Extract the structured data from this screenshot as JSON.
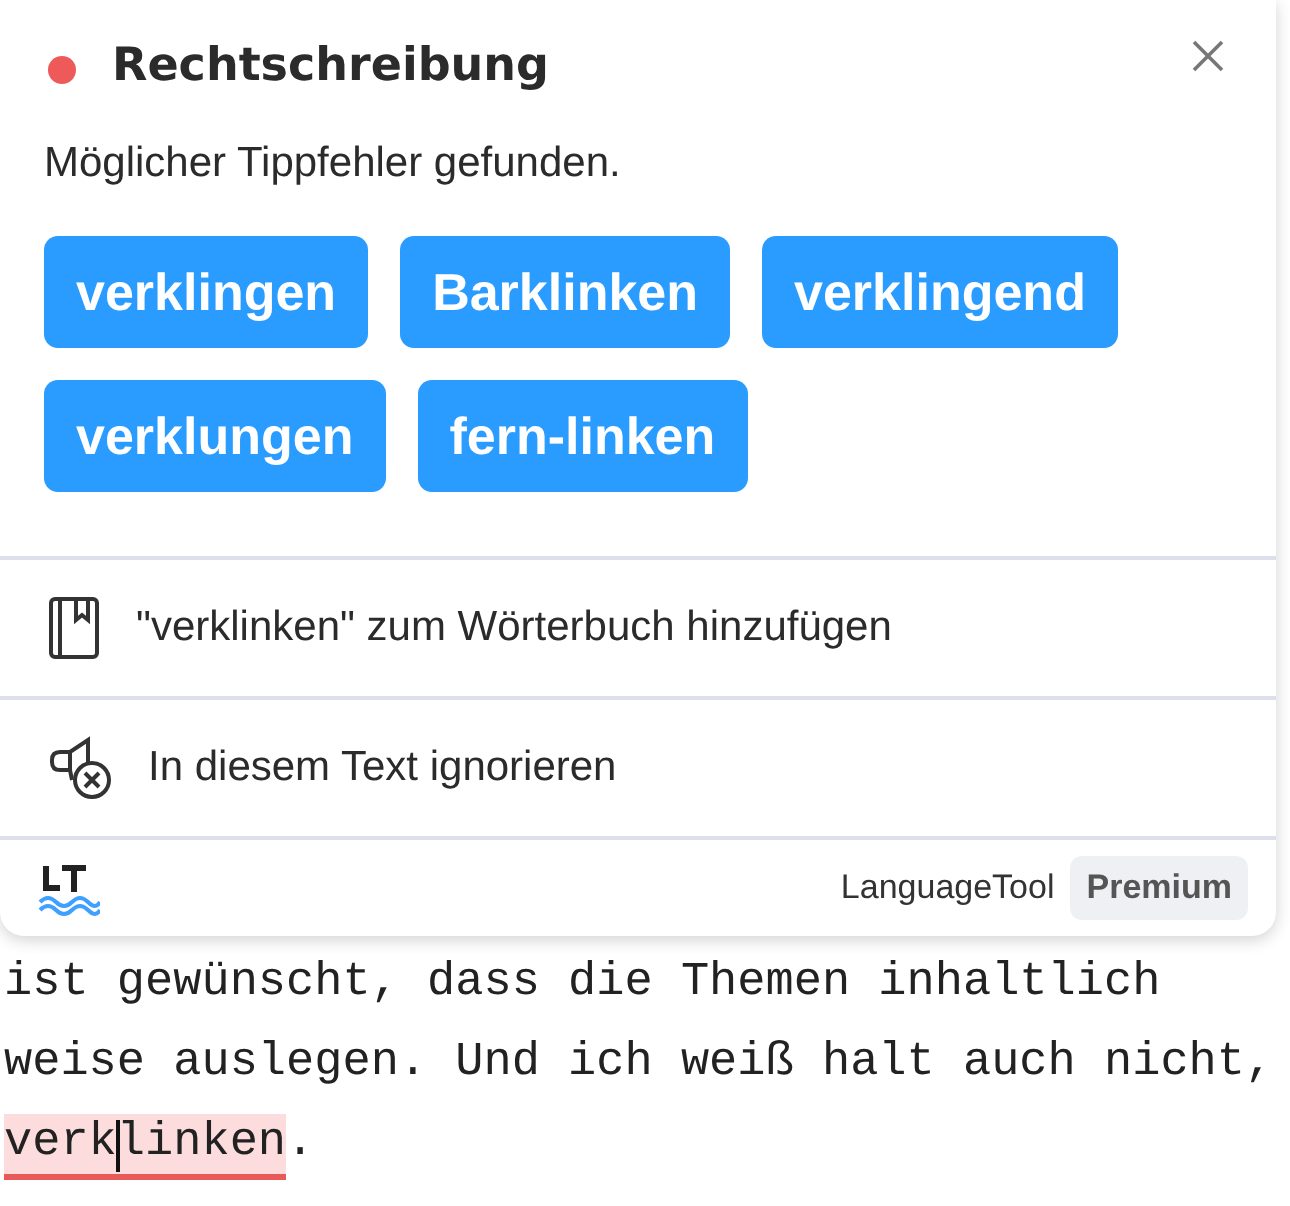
{
  "popup": {
    "category": {
      "title": "Rechtschreibung",
      "color": "#ee5a5a"
    },
    "message": "Möglicher Tippfehler gefunden.",
    "suggestions": [
      "verklingen",
      "Barklinken",
      "verklingend",
      "verklungen",
      "fern-linken"
    ],
    "actions": [
      {
        "kind": "dictionary",
        "label": "\"verklinken\" zum Wörterbuch hinzufügen"
      },
      {
        "kind": "ignore",
        "label": "In diesem Text ignorieren"
      }
    ],
    "footer": {
      "brand": "LanguageTool",
      "badge": "Premium"
    }
  },
  "editor": {
    "lines": [
      "ist gewünscht, dass die Themen inhaltlich",
      "weise auslegen. Und ich weiß halt auch nicht,"
    ],
    "error_word": "verklinken",
    "after_error": "."
  }
}
